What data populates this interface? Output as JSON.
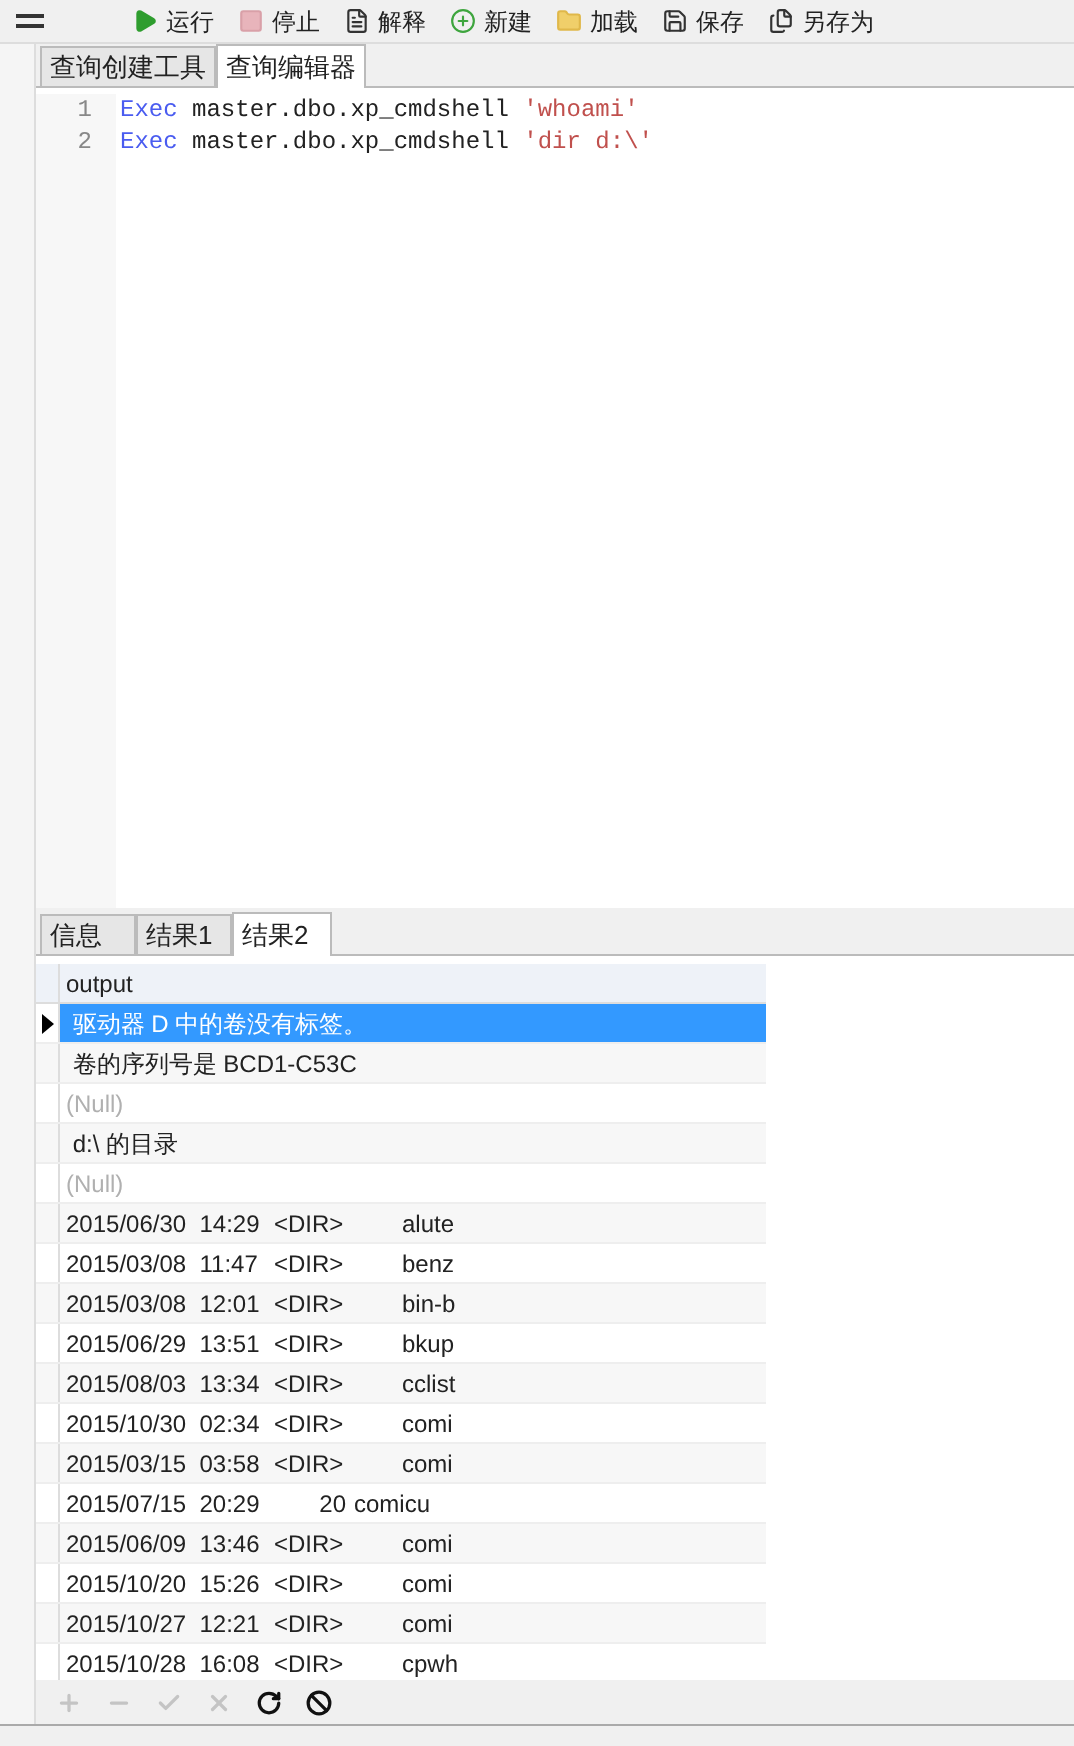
{
  "toolbar": [
    {
      "kind": "run",
      "label": "运行"
    },
    {
      "kind": "stop",
      "label": "停止"
    },
    {
      "kind": "explain",
      "label": "解释"
    },
    {
      "kind": "new",
      "label": "新建"
    },
    {
      "kind": "load",
      "label": "加载"
    },
    {
      "kind": "save",
      "label": "保存"
    },
    {
      "kind": "saveas",
      "label": "另存为"
    }
  ],
  "editor_tabs": [
    {
      "label": "查询创建工具",
      "selected": false
    },
    {
      "label": "查询编辑器",
      "selected": true
    }
  ],
  "code_lines": [
    {
      "number": "1",
      "keyword": "Exec",
      "code": "master.dbo.xp_cmdshell",
      "string": "'whoami'"
    },
    {
      "number": "2",
      "keyword": "Exec",
      "code": "master.dbo.xp_cmdshell",
      "string": "'dir d:\\'"
    }
  ],
  "result_tabs": [
    {
      "label": "信息",
      "selected": false
    },
    {
      "label": "结果1",
      "selected": false
    },
    {
      "label": "结果2",
      "selected": true
    }
  ],
  "table": {
    "columns": [
      "output"
    ],
    "rows": [
      {
        "kind": "text",
        "text": "驱动器 D 中的卷没有标签。",
        "selected": true
      },
      {
        "kind": "text",
        "text": "卷的序列号是 BCD1-C53C",
        "selected": false
      },
      {
        "kind": "null",
        "text": "(Null)",
        "selected": false
      },
      {
        "kind": "text",
        "text": "d:\\ 的目录",
        "selected": false
      },
      {
        "kind": "null",
        "text": "(Null)",
        "selected": false
      },
      {
        "kind": "dir",
        "date": "2015/06/30",
        "time": "14:29",
        "size": "<DIR>",
        "name": "alute",
        "selected": false
      },
      {
        "kind": "dir",
        "date": "2015/03/08",
        "time": "11:47",
        "size": "<DIR>",
        "name": "benz",
        "selected": false
      },
      {
        "kind": "dir",
        "date": "2015/03/08",
        "time": "12:01",
        "size": "<DIR>",
        "name": "bin-b",
        "selected": false
      },
      {
        "kind": "dir",
        "date": "2015/06/29",
        "time": "13:51",
        "size": "<DIR>",
        "name": "bkup",
        "selected": false
      },
      {
        "kind": "dir",
        "date": "2015/08/03",
        "time": "13:34",
        "size": "<DIR>",
        "name": "cclist",
        "selected": false
      },
      {
        "kind": "dir",
        "date": "2015/10/30",
        "time": "02:34",
        "size": "<DIR>",
        "name": "comi",
        "selected": false
      },
      {
        "kind": "dir",
        "date": "2015/03/15",
        "time": "03:58",
        "size": "<DIR>",
        "name": "comi",
        "selected": false
      },
      {
        "kind": "dir",
        "date": "2015/07/15",
        "time": "20:29",
        "size": "20",
        "name": "comicu",
        "selected": false
      },
      {
        "kind": "dir",
        "date": "2015/06/09",
        "time": "13:46",
        "size": "<DIR>",
        "name": "comi",
        "selected": false
      },
      {
        "kind": "dir",
        "date": "2015/10/20",
        "time": "15:26",
        "size": "<DIR>",
        "name": "comi",
        "selected": false
      },
      {
        "kind": "dir",
        "date": "2015/10/27",
        "time": "12:21",
        "size": "<DIR>",
        "name": "comi",
        "selected": false
      },
      {
        "kind": "dir",
        "date": "2015/10/28",
        "time": "16:08",
        "size": "<DIR>",
        "name": "cpwh",
        "selected": false
      }
    ]
  },
  "grid_toolbar": [
    {
      "kind": "add",
      "disabled": true
    },
    {
      "kind": "remove",
      "disabled": true
    },
    {
      "kind": "apply",
      "disabled": true
    },
    {
      "kind": "cancel",
      "disabled": true
    },
    {
      "kind": "refresh",
      "disabled": false
    },
    {
      "kind": "stop",
      "disabled": false
    }
  ]
}
